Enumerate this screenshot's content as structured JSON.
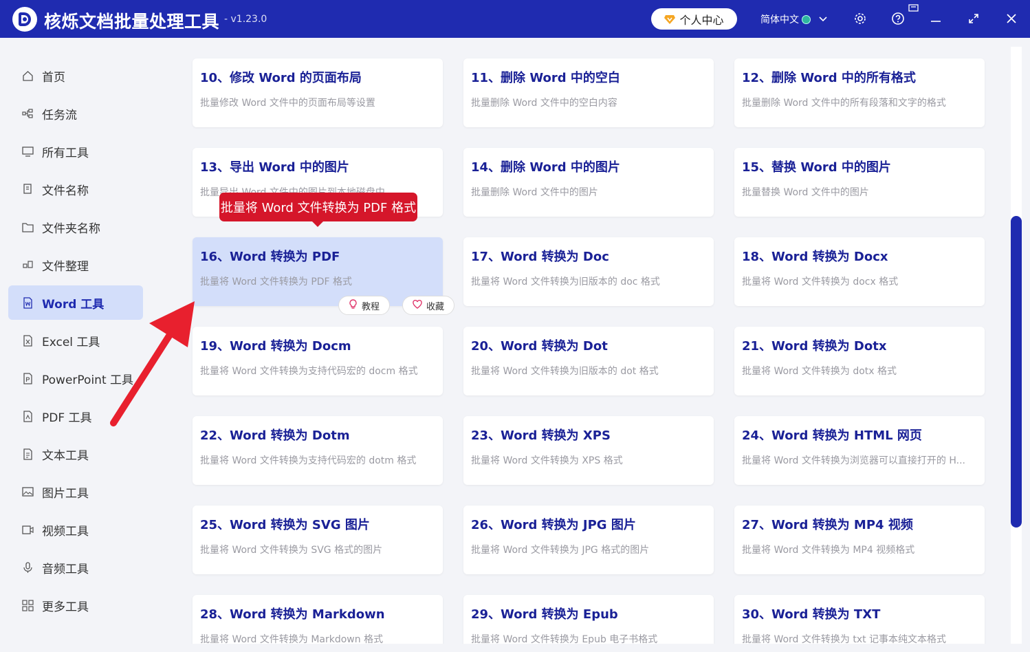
{
  "app": {
    "title": "核烁文档批量处理工具",
    "version": "- v1.23.0",
    "user_center": "个人中心",
    "language": "简体中文"
  },
  "icons": {
    "user_center": "vip-diamond-icon",
    "settings": "gear-icon",
    "help": "help-icon",
    "minimize": "minimize-icon",
    "maximize": "maximize-icon",
    "close": "close-icon",
    "tutorial": "bulb-icon",
    "favorite": "heart-icon"
  },
  "colors": {
    "brand": "#1f2bb0",
    "active_bg": "#d3defa",
    "tooltip": "#d5162a",
    "title_text": "#1a2196"
  },
  "sidebar": {
    "items": [
      {
        "label": "首页",
        "icon": "home-icon"
      },
      {
        "label": "任务流",
        "icon": "workflow-icon"
      },
      {
        "label": "所有工具",
        "icon": "monitor-icon"
      },
      {
        "label": "文件名称",
        "icon": "file-copy-icon"
      },
      {
        "label": "文件夹名称",
        "icon": "folder-icon"
      },
      {
        "label": "文件整理",
        "icon": "organize-icon"
      },
      {
        "label": "Word 工具",
        "icon": "word-file-icon",
        "active": true
      },
      {
        "label": "Excel 工具",
        "icon": "excel-file-icon"
      },
      {
        "label": "PowerPoint 工具",
        "icon": "ppt-file-icon"
      },
      {
        "label": "PDF 工具",
        "icon": "pdf-file-icon"
      },
      {
        "label": "文本工具",
        "icon": "text-file-icon"
      },
      {
        "label": "图片工具",
        "icon": "image-icon"
      },
      {
        "label": "视频工具",
        "icon": "video-icon"
      },
      {
        "label": "音频工具",
        "icon": "microphone-icon"
      },
      {
        "label": "更多工具",
        "icon": "grid-icon"
      }
    ]
  },
  "cards": [
    {
      "title": "10、修改 Word 的页面布局",
      "desc": "批量修改 Word 文件中的页面布局等设置"
    },
    {
      "title": "11、删除 Word 中的空白",
      "desc": "批量删除 Word 文件中的空白内容"
    },
    {
      "title": "12、删除 Word 中的所有格式",
      "desc": "批量删除 Word 文件中的所有段落和文字的格式"
    },
    {
      "title": "13、导出 Word 中的图片",
      "desc": "批量导出 Word 文件中的图片到本地磁盘中"
    },
    {
      "title": "14、删除 Word 中的图片",
      "desc": "批量删除 Word 文件中的图片"
    },
    {
      "title": "15、替换 Word 中的图片",
      "desc": "批量替换 Word 文件中的图片"
    },
    {
      "title": "16、Word 转换为 PDF",
      "desc": "批量将 Word 文件转换为 PDF 格式",
      "highlighted": true
    },
    {
      "title": "17、Word 转换为 Doc",
      "desc": "批量将 Word 文件转换为旧版本的 doc 格式"
    },
    {
      "title": "18、Word 转换为 Docx",
      "desc": "批量将 Word 文件转换为 docx 格式"
    },
    {
      "title": "19、Word 转换为 Docm",
      "desc": "批量将 Word 文件转换为支持代码宏的 docm 格式"
    },
    {
      "title": "20、Word 转换为 Dot",
      "desc": "批量将 Word 文件转换为旧版本的 dot 格式"
    },
    {
      "title": "21、Word 转换为 Dotx",
      "desc": "批量将 Word 文件转换为 dotx 格式"
    },
    {
      "title": "22、Word 转换为 Dotm",
      "desc": "批量将 Word 文件转换为支持代码宏的 dotm 格式"
    },
    {
      "title": "23、Word 转换为 XPS",
      "desc": "批量将 Word 文件转换为 XPS 格式"
    },
    {
      "title": "24、Word 转换为 HTML 网页",
      "desc": "批量将 Word 文件转换为浏览器可以直接打开的 H..."
    },
    {
      "title": "25、Word 转换为 SVG 图片",
      "desc": "批量将 Word 文件转换为 SVG 格式的图片"
    },
    {
      "title": "26、Word 转换为 JPG 图片",
      "desc": "批量将 Word 文件转换为 JPG 格式的图片"
    },
    {
      "title": "27、Word 转换为 MP4 视频",
      "desc": "批量将 Word 文件转换为 MP4 视频格式"
    },
    {
      "title": "28、Word 转换为 Markdown",
      "desc": "批量将 Word 文件转换为 Markdown 格式"
    },
    {
      "title": "29、Word 转换为 Epub",
      "desc": "批量将 Word 文件转换为 Epub 电子书格式"
    },
    {
      "title": "30、Word 转换为 TXT",
      "desc": "批量将 Word 文件转换为 txt 记事本纯文本格式"
    }
  ],
  "card_actions": {
    "tutorial": "教程",
    "favorite": "收藏"
  },
  "tooltip": {
    "text": "批量将 Word 文件转换为 PDF 格式"
  }
}
